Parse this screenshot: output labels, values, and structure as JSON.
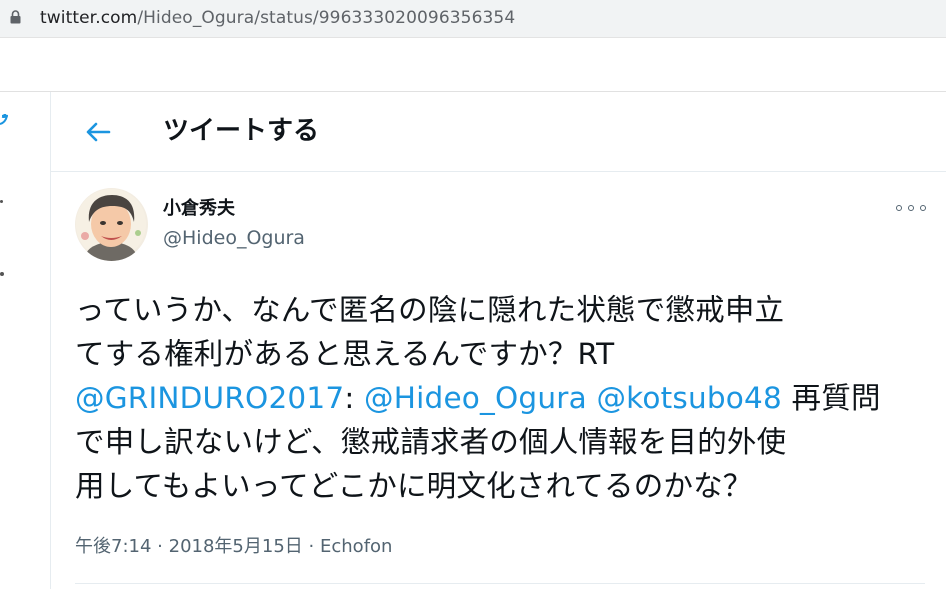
{
  "browser": {
    "url_host": "twitter.com",
    "url_path": "/Hideo_Ogura/status/996333020096356354"
  },
  "header": {
    "title": "ツイートする"
  },
  "tweet": {
    "display_name": "小倉秀夫",
    "handle": "@Hideo_Ogura",
    "text_lines": {
      "l1": "っていうか、なんで匿名の陰に隠れた状態で懲戒申立",
      "l2": "てする権利があると思えるんですか？RT",
      "l3_mention1": "@GRINDURO2017",
      "l3_colon": ":",
      "l3_mention2": "@Hideo_Ogura",
      "l3_mention3": "@kotsubo48",
      "l3_rest": "再質問",
      "l4": "で申し訳ないけど、懲戒請求者の個人情報を目的外使",
      "l5": "用してもよいってどこかに明文化されてるのかな？"
    },
    "time": "午後7:14",
    "sep": "·",
    "date": "2018年5月15日",
    "source": "Echofon"
  },
  "colors": {
    "accent": "#1b95e0",
    "text": "#0f1419",
    "secondary": "#536471",
    "border": "#e6ecf0"
  },
  "icons": {
    "lock": "lock-icon",
    "back": "back-arrow-icon",
    "more": "more-options-icon"
  }
}
